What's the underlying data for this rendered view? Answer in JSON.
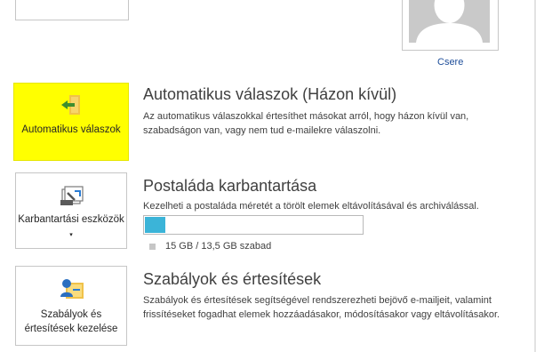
{
  "avatar": {
    "change_label": "Csere"
  },
  "auto_reply": {
    "tile_label": "Automatikus válaszok",
    "title": "Automatikus válaszok (Házon kívül)",
    "description": "Az automatikus válaszokkal értesíthet másokat arról, hogy házon kívül van, szabadságon van, vagy nem tud e-mailekre válaszolni.",
    "highlight_color": "#ffff00"
  },
  "mailbox_cleanup": {
    "tile_label": "Karbantartási eszközök",
    "title": "Postaláda karbantartása",
    "description": "Kezelheti a postaláda méretét a törölt elemek eltávolításával és archiválással.",
    "storage_text": "15 GB / 13,5 GB szabad",
    "usage_fraction": 0.1,
    "bar_color": "#3bb4d8"
  },
  "rules": {
    "tile_label": "Szabályok és értesítések kezelése",
    "title": "Szabályok és értesítések",
    "description": "Szabályok és értesítések segítségével rendszerezheti bejövő e-mailjeit, valamint frissítéseket fogadhat elemek hozzáadásakor, módosításakor vagy eltávolításakor."
  }
}
